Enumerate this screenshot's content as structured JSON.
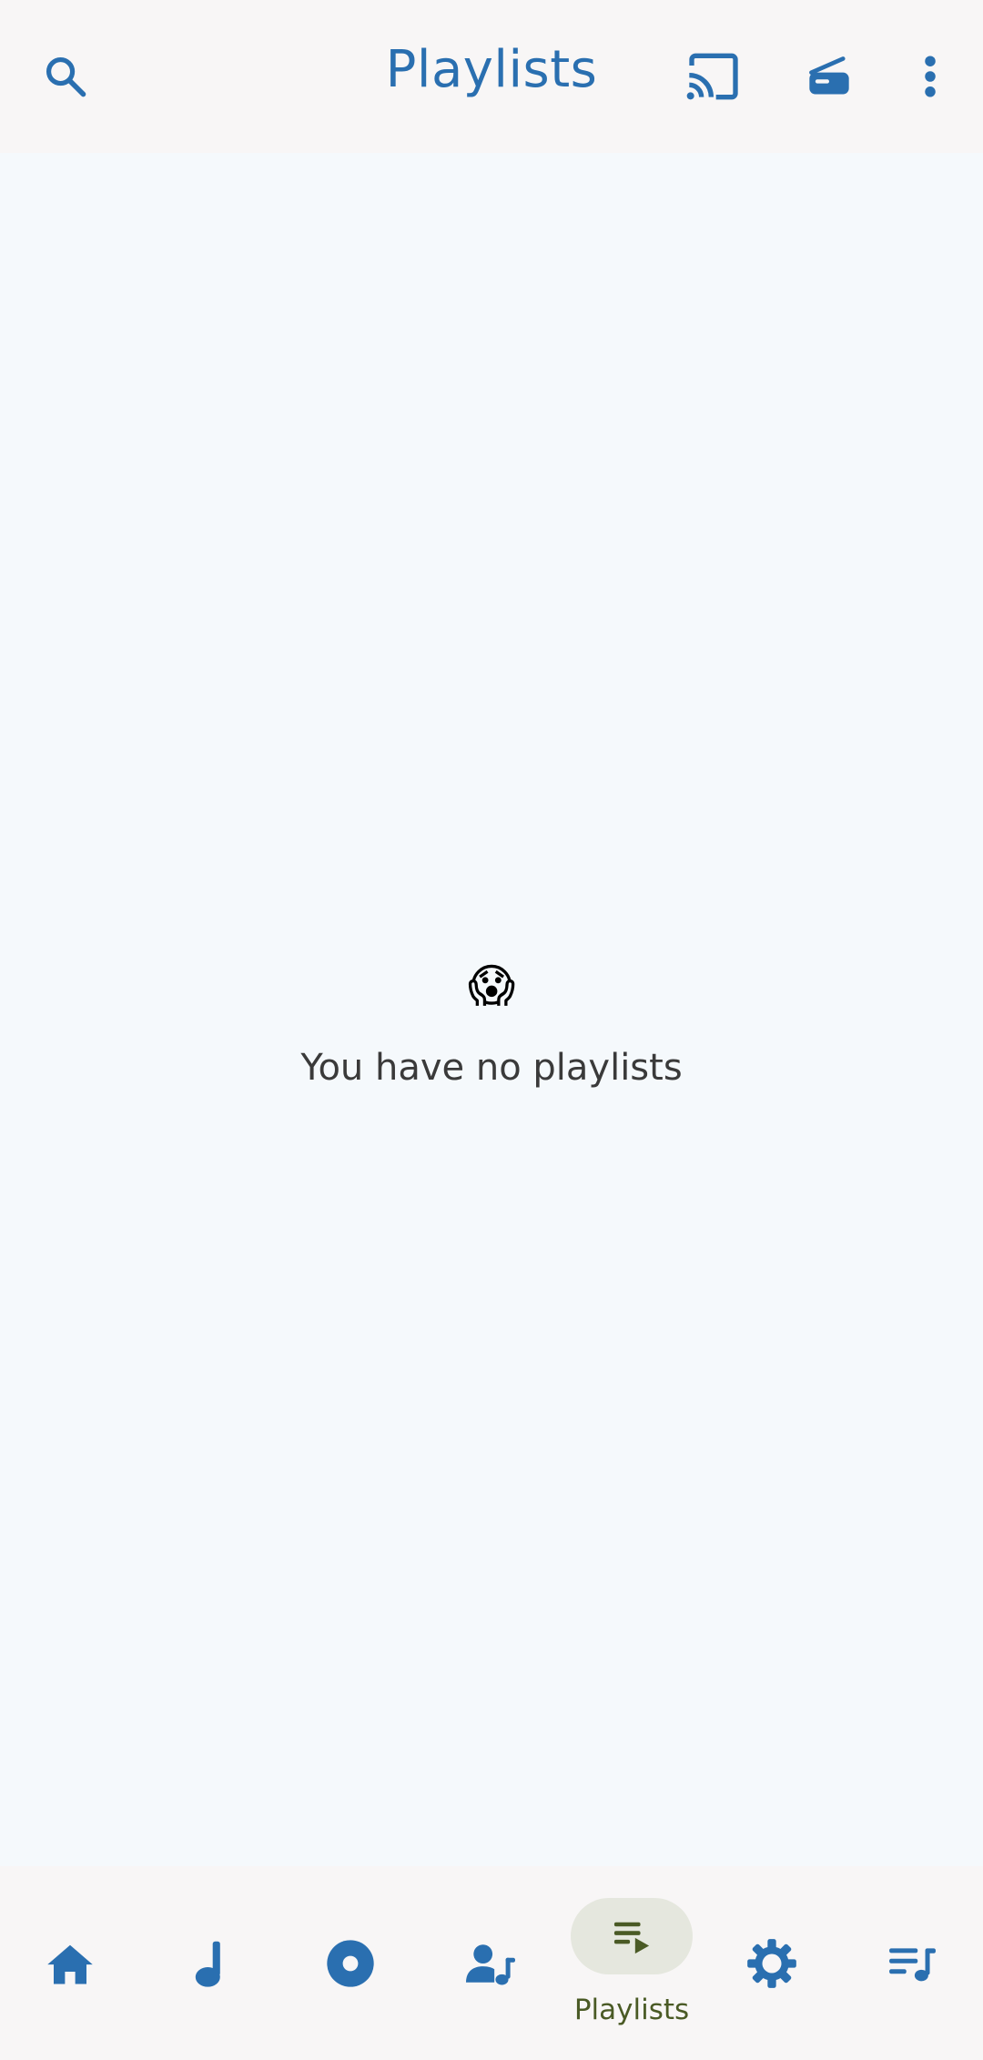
{
  "header": {
    "title": "Playlists",
    "icons": [
      "search-icon",
      "cast-icon",
      "radio-icon",
      "more-vert-icon"
    ]
  },
  "empty_state": {
    "emoji": "😱",
    "message": "You have no playlists"
  },
  "bottom_nav": {
    "items": [
      {
        "icon": "home-icon",
        "label": "",
        "active": false
      },
      {
        "icon": "music-note-icon",
        "label": "",
        "active": false
      },
      {
        "icon": "album-icon",
        "label": "",
        "active": false
      },
      {
        "icon": "artist-icon",
        "label": "",
        "active": false
      },
      {
        "icon": "playlist-play-icon",
        "label": "Playlists",
        "active": true
      },
      {
        "icon": "settings-icon",
        "label": "",
        "active": false
      },
      {
        "icon": "queue-music-icon",
        "label": "",
        "active": false
      }
    ]
  },
  "colors": {
    "accent": "#2a6fb0",
    "active_label": "#4a5a25",
    "active_pill": "#e5e7de",
    "background": "#f5f9fc",
    "bar_background": "#f8f6f6"
  }
}
